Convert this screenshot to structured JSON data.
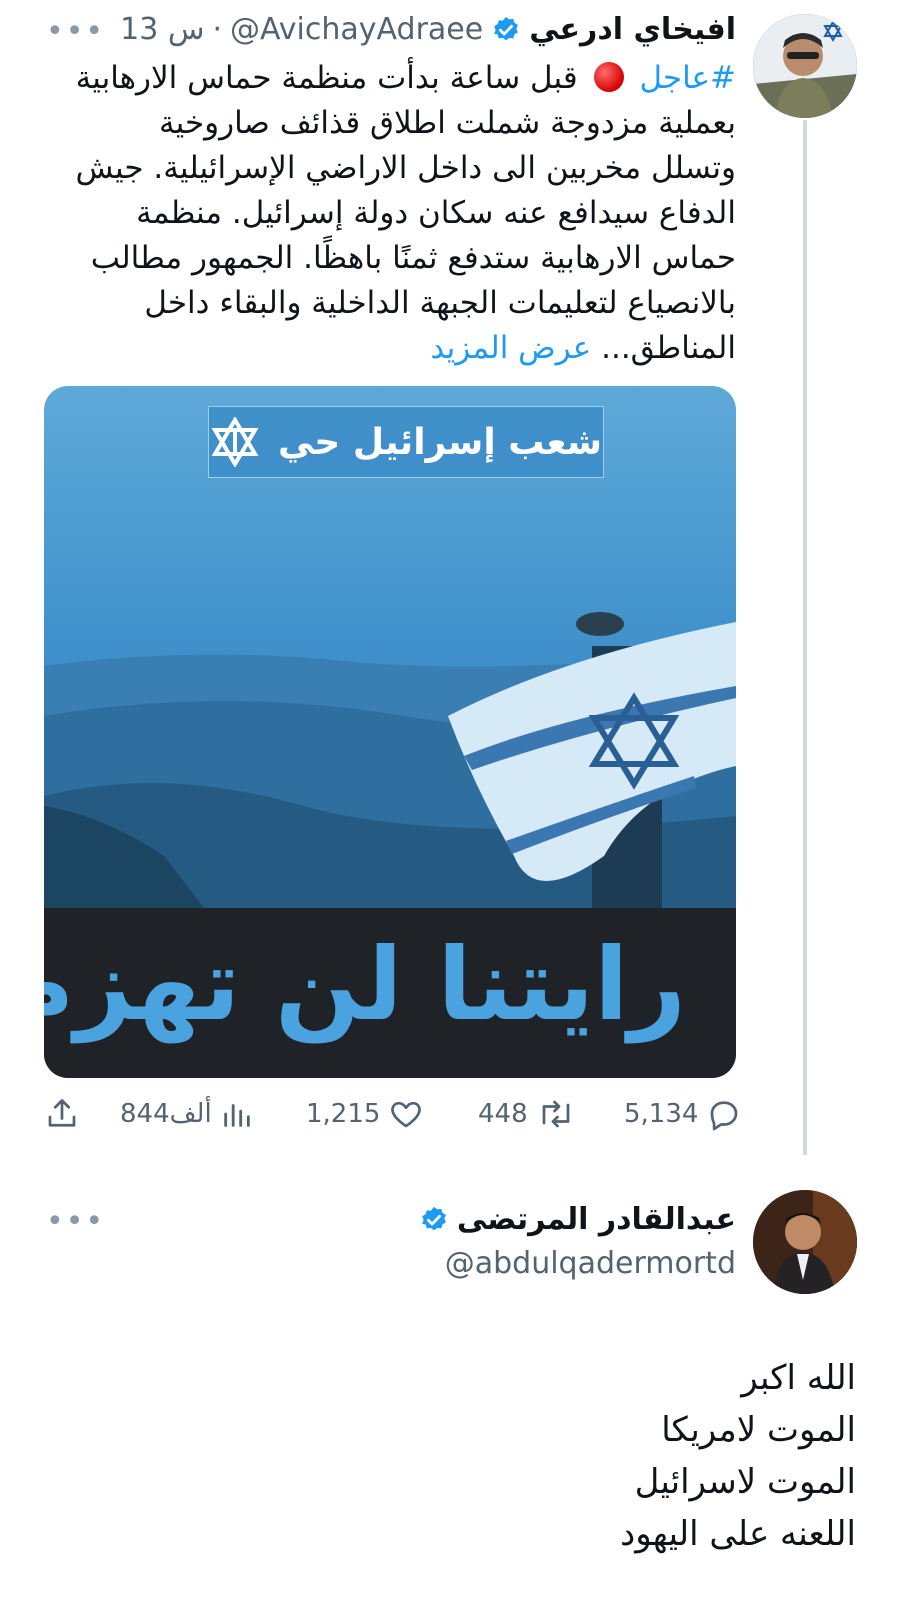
{
  "tweet": {
    "author_name": "افيخاي ادرعي",
    "handle": "@AvichayAdraee",
    "separator": "·",
    "time": "13 س",
    "more": "•••",
    "hashtag": "#عاجل",
    "body_lines": [
      "قبل ساعة بدأت منظمة حماس الارهابية",
      "بعملية مزدوجة شملت اطلاق قذائف صاروخية",
      "وتسلل مخربين الى داخل الاراضي الإسرائيلية. جيش",
      "الدفاع سيدافع عنه سكان دولة إسرائيل. منظمة",
      "حماس الارهابية ستدفع ثمنًا باهظًا. الجمهور مطالب",
      "بالانصياع لتعليمات الجبهة الداخلية والبقاء داخل"
    ],
    "last_line": "المناطق...",
    "show_more": "عرض المزيد",
    "media": {
      "top_label": "شعب إسرائيل حي",
      "banner": "رايتنا لن تهزم"
    },
    "actions": {
      "replies": "5,134",
      "retweets": "448",
      "likes": "1,215",
      "views": "844ألف"
    }
  },
  "reply": {
    "author_name": "عبدالقادر المرتضى",
    "handle": "@abdulqadermortd",
    "more": "•••",
    "lines": [
      "الله اكبر",
      "الموت لامريكا",
      "الموت لاسرائيل",
      "اللعنه على اليهود"
    ]
  },
  "colors": {
    "link": "#1d9bf0",
    "muted": "#536471",
    "text": "#0f1419",
    "verified": "#1d9bf0"
  }
}
